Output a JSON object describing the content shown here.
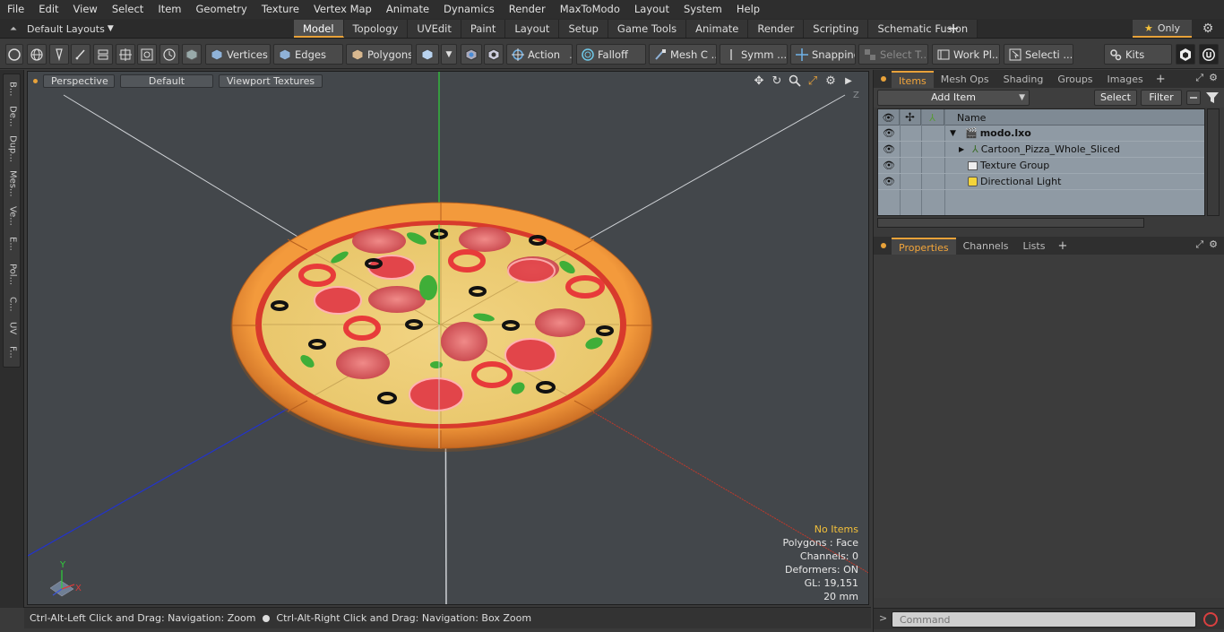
{
  "menubar": {
    "items": [
      "File",
      "Edit",
      "View",
      "Select",
      "Item",
      "Geometry",
      "Texture",
      "Vertex Map",
      "Animate",
      "Dynamics",
      "Render",
      "MaxToModo",
      "Layout",
      "System",
      "Help"
    ]
  },
  "tabbar": {
    "layout_label": "Default Layouts",
    "tabs": [
      "Model",
      "Topology",
      "UVEdit",
      "Paint",
      "Layout",
      "Setup",
      "Game Tools",
      "Animate",
      "Render",
      "Scripting",
      "Schematic Fusion"
    ],
    "active_tab": "Model",
    "plus": "+",
    "only_label": "Only"
  },
  "toolbar": {
    "vertices": "Vertices",
    "edges": "Edges",
    "polygons": "Polygons",
    "action": "Action",
    "falloff": "Falloff",
    "mesh": "Mesh C ...",
    "symm": "Symm ...",
    "snapping": "Snapping",
    "select_t": "Select T...",
    "work_pl": "Work Pl...",
    "selecti": "Selecti ...",
    "kits": "Kits"
  },
  "left_tabs": [
    "B...",
    "De...",
    "Dup...",
    "Mes...",
    "Ve...",
    "E...",
    "Pol...",
    "C...",
    "UV",
    "F..."
  ],
  "viewport": {
    "perspective": "Perspective",
    "default": "Default",
    "textures": "Viewport Textures",
    "stats": {
      "no_items": "No Items",
      "polygons": "Polygons : Face",
      "channels": "Channels: 0",
      "deformers": "Deformers: ON",
      "gl": "GL: 19,151",
      "scale": "20 mm"
    },
    "axis": {
      "x": "X",
      "y": "Y",
      "z": "Z"
    }
  },
  "status": {
    "zoom": "Ctrl-Alt-Left Click and Drag: Navigation: Zoom",
    "box_zoom": "Ctrl-Alt-Right Click and Drag: Navigation: Box Zoom"
  },
  "items_panel": {
    "tabs": [
      "Items",
      "Mesh Ops",
      "Shading",
      "Groups",
      "Images"
    ],
    "active_tab": "Items",
    "plus": "+",
    "add_item": "Add Item",
    "select": "Select",
    "filter": "Filter",
    "column_name": "Name",
    "rows": [
      {
        "label": "modo.lxo",
        "expander": "▼",
        "bold": true
      },
      {
        "label": "Cartoon_Pizza_Whole_Sliced",
        "expander": "▶",
        "bold": false
      },
      {
        "label": "Texture Group",
        "expander": "",
        "bold": false
      },
      {
        "label": "Directional Light",
        "expander": "",
        "bold": false
      }
    ]
  },
  "props_panel": {
    "tabs": [
      "Properties",
      "Channels",
      "Lists"
    ],
    "active_tab": "Properties",
    "plus": "+"
  },
  "command": {
    "placeholder": "Command",
    "prompt": ">"
  },
  "colors": {
    "accent": "#e8a23a",
    "star": "#f3c03a",
    "record": "#d94040"
  }
}
